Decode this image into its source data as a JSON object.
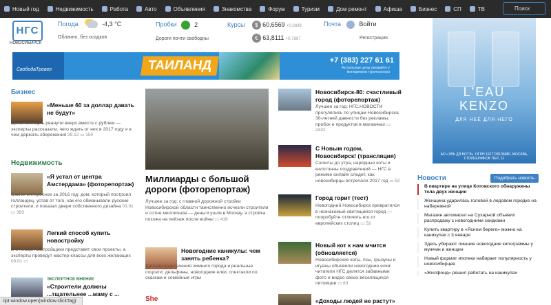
{
  "nav": {
    "items": [
      "Новый год",
      "Недвижимость",
      "Работа",
      "Авто",
      "Объявления",
      "Знакомства",
      "Форум",
      "Туризм",
      "Дом ремонт",
      "Афиша",
      "Бизнес",
      "СП",
      "ТВ"
    ],
    "search": "Поиск"
  },
  "header": {
    "logo": "НГС",
    "logo_sub": "НОВОСИБИРСК",
    "weather_label": "Погода",
    "weather_temp": "-4,3 °С",
    "weather_desc": "Облачно, без осадков",
    "traffic_label": "Пробки",
    "traffic_level": "2",
    "traffic_desc": "Дороги почти свободны",
    "rates_label": "Курсы",
    "usd": "60,6569",
    "usd_delta": "+0,3839",
    "eur": "63,8111",
    "eur_delta": "+0,7897",
    "mail_label": "Почта",
    "login": "Войти",
    "register": "Регистрация"
  },
  "banner": {
    "logo": "СвободаТревел",
    "title": "ТАИЛАНД",
    "phone": "+7 (383) 227 61 61",
    "note": "Актуальные цены узнавайте у менеджеров туроператора"
  },
  "ad": {
    "brand": "L'EAU\nKENZO",
    "sub": "ДЛЯ НЕЁ ДЛЯ НЕГО",
    "small": "АО «ЭЛЬ ДЭ БОТЭ». ОГРН 1027739136880, МОСКВА, СТОЛЕШНИКОВ ПЕР., 11"
  },
  "sections": {
    "business": "Бизнес",
    "realty": "Недвижимость",
    "news": "Новости",
    "she": "She"
  },
  "news_button": "Подобрать новость",
  "col1": [
    {
      "title": "«Меньше 60 за доллар давать не будут»",
      "text": "Цены на нефть рванули вверх вместе с рублем — эксперты рассказали, чего ждать от них в 2017 году и в чем держать сбережения",
      "date": "29.12",
      "count": "150"
    },
    {
      "title": "«Я устал от центра Амстердама» (фоторепортаж)",
      "text": "Самое интересное за 2016 год: дом, который построил голландец, устав от того, как его обманывали русские строители, и показал двери собственного дизайна",
      "date": "03.01",
      "count": "393"
    },
    {
      "title": "Легкий способ купить новостройку",
      "text": "В 8 января застройщики представят свои проекты, а эксперты проведут мастер-классы для всех желающих",
      "date": "03.01",
      "count": ""
    }
  ],
  "expert": {
    "label": "ЭКСПЕРТНОЕ МНЕНИЕ",
    "title": "«Строители должны ...тщательнее ...маму с ..."
  },
  "col2": {
    "big_title": "Миллиарды с большой дороги (фоторепортаж)",
    "big_text": "Лучшее за год: с главной дорожной стройки Новосибирской области таинственно исчезли строители и сотня миллионов — деньги ушли в Москву, а стройка похожа на пейзаж после войны",
    "big_count": "418",
    "small_title": "Новогодние каникулы: чем занять ребенка?",
    "small_text": "Детские развлечения зимнего города и реальные соцсети: дельфины, новогодние елки, спектакли по сказкам и семейные игры"
  },
  "col3": [
    {
      "title": "Новосибирск-80: счастливый город (фоторепортаж)",
      "text": "Лучшее за год: НГС.НОВОСТИ прогулялись по улицам Новосибирска 30-летней давности без рекламы, пробок и продуктов в магазинах",
      "count": "2432"
    },
    {
      "title": "С Новым годом, Новосибирск! (трансляция)",
      "text": "Салюты до утра, нарядные коты и килотонны поздравлений — НГС в режиме онлайн следит, как новосибирцы встречали 2017 год",
      "count": "52"
    },
    {
      "title": "Город горит (тест)",
      "text": "Новогодний Новосибирск превратился в незнакомый светящийся город — попробуйте отличить его от европейских столиц",
      "count": "52"
    },
    {
      "title": "Новый кот к нам мчится (обновляется)",
      "text": "Новосибирские коты, псы, грызуны и игуаны обновили новогодние елки: читатели НГС делятся забавными фото и видео своих веселящихся питомцев",
      "count": "63"
    },
    {
      "title": "«Доходы людей не растут»",
      "text": "",
      "count": ""
    }
  ],
  "news": [
    "В квартире на улице Котовского обнаружены тела двух женщин",
    "Женщина ударилась головой в ледовом городке на набережной",
    "Магазин автомасел на Сухарной объявил распродажу с новогодними скидками",
    "Купить квартиру в «Ясном береге» можно на каникулах с 3 января",
    "Здесь убирают лишние новогодние килограммы у мужчин и женщин",
    "Новый формат ипотеки набирает популярность у новосибирцев",
    "«Жилфонд» решил работать на каникулах"
  ],
  "status": "ript:window.open(window.clickTag)"
}
